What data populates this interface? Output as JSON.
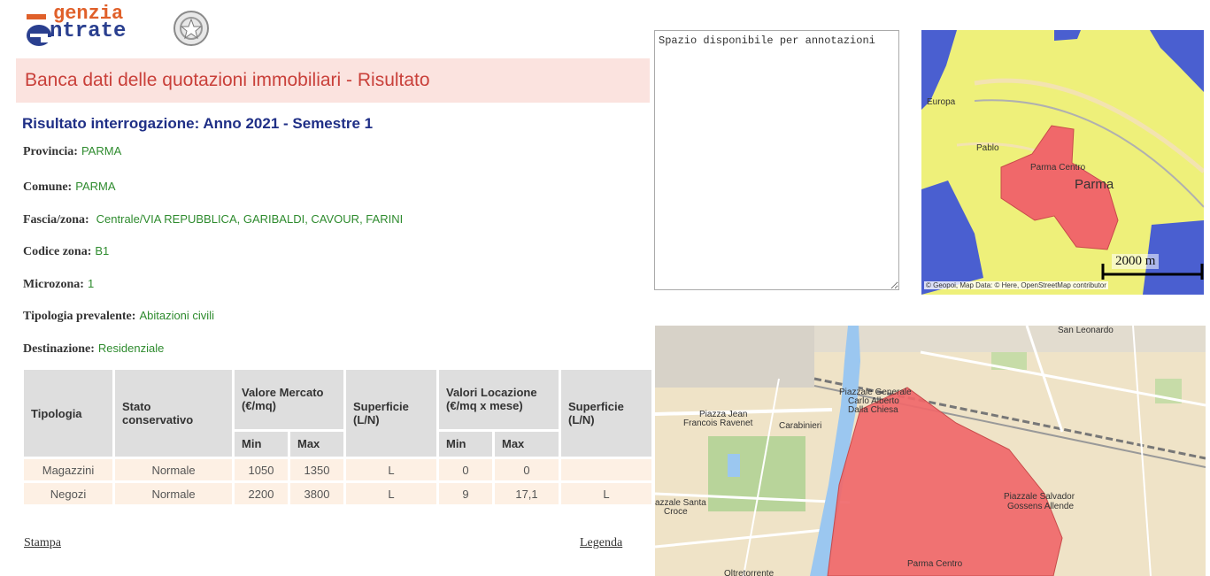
{
  "logo": {
    "line1": "genzia",
    "line2": "ntrate"
  },
  "page_title": "Banca dati delle quotazioni immobiliari - Risultato",
  "result_title": "Risultato interrogazione: Anno 2021 - Semestre 1",
  "fields": {
    "provincia": {
      "label": "Provincia:",
      "value": "PARMA"
    },
    "comune": {
      "label": "Comune:",
      "value": "PARMA"
    },
    "fascia": {
      "label": "Fascia/zona:",
      "value": "Centrale/VIA REPUBBLICA, GARIBALDI, CAVOUR, FARINI"
    },
    "codice": {
      "label": "Codice zona:",
      "value": "B1"
    },
    "microzona": {
      "label": "Microzona:",
      "value": "1"
    },
    "tipologia": {
      "label": "Tipologia prevalente:",
      "value": "Abitazioni civili"
    },
    "destinazione": {
      "label": "Destinazione:",
      "value": "Residenziale"
    }
  },
  "table": {
    "headers": {
      "tipologia": "Tipologia",
      "stato": "Stato conservativo",
      "valore_mercato": "Valore Mercato (€/mq)",
      "superficie": "Superficie (L/N)",
      "valori_locazione": "Valori Locazione (€/mq x mese)",
      "superficie2": "Superficie (L/N)",
      "min": "Min",
      "max": "Max"
    },
    "rows": [
      {
        "tipologia": "Magazzini",
        "stato": "Normale",
        "min": "1050",
        "max": "1350",
        "superficie": "L",
        "loc_min": "0",
        "loc_max": "0",
        "superficie2": ""
      },
      {
        "tipologia": "Negozi",
        "stato": "Normale",
        "min": "2200",
        "max": "3800",
        "superficie": "L",
        "loc_min": "9",
        "loc_max": "17,1",
        "superficie2": "L"
      }
    ]
  },
  "links": {
    "stampa": "Stampa",
    "legenda": "Legenda"
  },
  "notes": {
    "text": "Spazio disponibile per annotazioni"
  },
  "map_small": {
    "labels": {
      "pablo": "Pablo",
      "parma_centro": "Parma Centro",
      "parma": "Parma",
      "europa": "Europa"
    },
    "scale": "2000 m",
    "attribution": "© Geopoi, Map Data: © Here, OpenStreetMap contributor"
  },
  "map_big": {
    "labels": {
      "piazzale_generale": "Piazzale Generale",
      "carlo_alberto": "Carlo Alberto",
      "dalla_chiesa": "Dalla Chiesa",
      "piazza_jean": "Piazza Jean",
      "francois": "Francois Ravenet",
      "carabinieri": "Carabinieri",
      "piazzale_salvador": "Piazzale Salvador",
      "gossens": "Gossens Allende",
      "santa_croce_1": "azzale Santa",
      "santa_croce_2": "Croce",
      "parma_centro": "Parma Centro",
      "oltretorrente": "Oltretorrente",
      "san_leonardo": "San Leonardo"
    }
  },
  "colors": {
    "zone_red": "#f0686a",
    "zone_yellow": "#eef07a",
    "zone_blue": "#4a5fd0",
    "title_red": "#c9403a",
    "value_green": "#2e8b2e"
  }
}
